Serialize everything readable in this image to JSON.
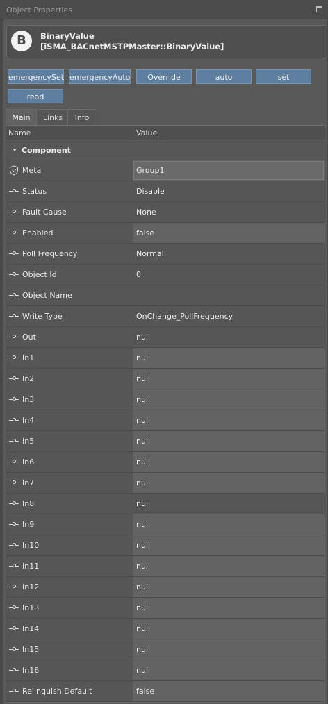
{
  "window": {
    "title": "Object Properties"
  },
  "header": {
    "badge": "B",
    "name": "BinaryValue",
    "type": "[iSMA_BACnetMSTPMaster::BinaryValue]"
  },
  "actions": [
    "emergencySet",
    "emergencyAuto",
    "Override",
    "auto",
    "set",
    "read"
  ],
  "tabs": [
    "Main",
    "Links",
    "Info"
  ],
  "grid": {
    "columns": {
      "name": "Name",
      "value": "Value"
    },
    "section": "Component",
    "rows": [
      {
        "name": "Meta",
        "value": "Group1"
      },
      {
        "name": "Status",
        "value": "Disable"
      },
      {
        "name": "Fault Cause",
        "value": "None"
      },
      {
        "name": "Enabled",
        "value": "false"
      },
      {
        "name": "Poll Frequency",
        "value": "Normal"
      },
      {
        "name": "Object Id",
        "value": "0"
      },
      {
        "name": "Object Name",
        "value": ""
      },
      {
        "name": "Write Type",
        "value": "OnChange_PollFrequency"
      },
      {
        "name": "Out",
        "value": "null"
      },
      {
        "name": "In1",
        "value": "null"
      },
      {
        "name": "In2",
        "value": "null"
      },
      {
        "name": "In3",
        "value": "null"
      },
      {
        "name": "In4",
        "value": "null"
      },
      {
        "name": "In5",
        "value": "null"
      },
      {
        "name": "In6",
        "value": "null"
      },
      {
        "name": "In7",
        "value": "null"
      },
      {
        "name": "In8",
        "value": "null"
      },
      {
        "name": "In9",
        "value": "null"
      },
      {
        "name": "In10",
        "value": "null"
      },
      {
        "name": "In11",
        "value": "null"
      },
      {
        "name": "In12",
        "value": "null"
      },
      {
        "name": "In13",
        "value": "null"
      },
      {
        "name": "In14",
        "value": "null"
      },
      {
        "name": "In15",
        "value": "null"
      },
      {
        "name": "In16",
        "value": "null"
      },
      {
        "name": "Relinquish Default",
        "value": "false"
      }
    ]
  }
}
